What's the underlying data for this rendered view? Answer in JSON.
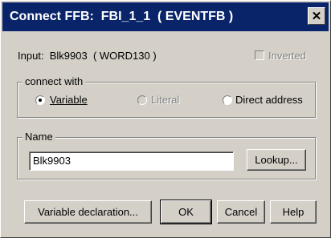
{
  "window": {
    "title": "Connect FFB:  FBI_1_1  ( EVENTFB )",
    "close_glyph": "✕"
  },
  "input_info": "Input:  Blk9903  ( WORD130 )",
  "inverted": {
    "label": "Inverted",
    "checked": false,
    "enabled": false
  },
  "connect_with": {
    "legend": "connect with",
    "options": [
      {
        "label": "Variable",
        "selected": true,
        "enabled": true
      },
      {
        "label": "Literal",
        "selected": false,
        "enabled": false
      },
      {
        "label": "Direct address",
        "selected": false,
        "enabled": true
      }
    ]
  },
  "name_group": {
    "legend": "Name",
    "value": "Blk9903",
    "lookup_label": "Lookup..."
  },
  "buttons": {
    "variable_declaration": "Variable declaration...",
    "ok": "OK",
    "cancel": "Cancel",
    "help": "Help"
  }
}
